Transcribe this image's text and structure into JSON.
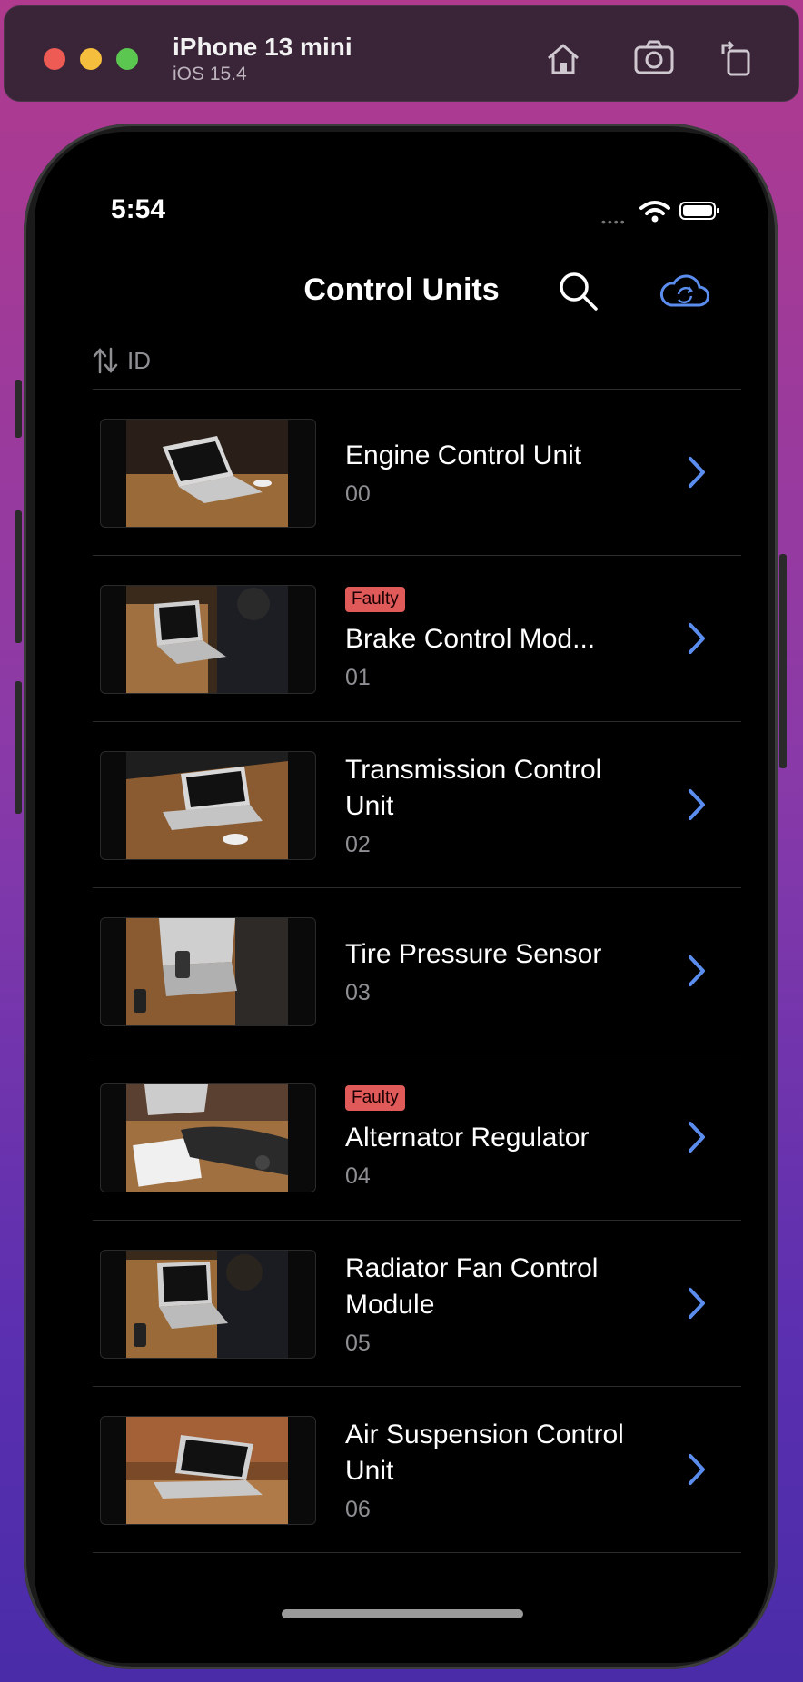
{
  "simulator": {
    "device_name": "iPhone 13 mini",
    "os_version": "iOS 15.4",
    "toolbar_icons": [
      "home-icon",
      "screenshot-icon",
      "rotate-icon"
    ]
  },
  "status_bar": {
    "time": "5:54"
  },
  "nav": {
    "title": "Control Units",
    "search_icon": "search-icon",
    "sync_icon": "cloud-sync-icon",
    "accent_color": "#5b8def"
  },
  "sort": {
    "icon": "sort-arrows-icon",
    "label": "ID"
  },
  "units": [
    {
      "name": "Engine Control Unit",
      "id": "00",
      "badge": ""
    },
    {
      "name": "Brake Control Mod...",
      "id": "01",
      "badge": "Faulty"
    },
    {
      "name": "Transmission Control Unit",
      "id": "02",
      "badge": ""
    },
    {
      "name": "Tire Pressure Sensor",
      "id": "03",
      "badge": ""
    },
    {
      "name": "Alternator Regulator",
      "id": "04",
      "badge": "Faulty"
    },
    {
      "name": "Radiator Fan Control Module",
      "id": "05",
      "badge": ""
    },
    {
      "name": "Air Suspension Control Unit",
      "id": "06",
      "badge": ""
    }
  ],
  "colors": {
    "faulty_badge": "#e05a5a",
    "chevron": "#5b8def"
  }
}
